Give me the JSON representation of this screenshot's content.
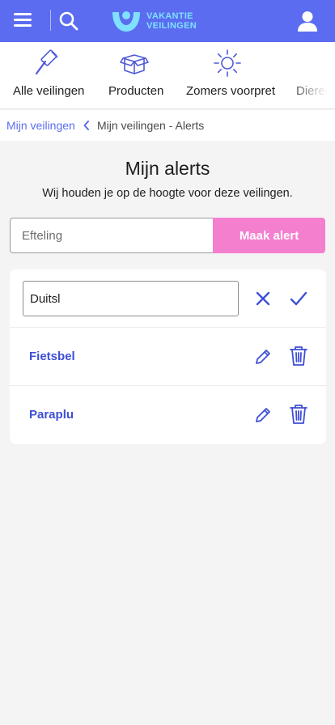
{
  "header": {
    "logo_line1": "VAKANTIE",
    "logo_line2": "VEILINGEN",
    "icons": [
      "menu-icon",
      "search-icon",
      "user-icon"
    ],
    "colors": {
      "bar": "#5b6cf0",
      "logo_text": "#7fe1ff"
    }
  },
  "categories": [
    {
      "label": "Alle veilingen",
      "icon": "gavel-icon"
    },
    {
      "label": "Producten",
      "icon": "box-icon"
    },
    {
      "label": "Zomers voorpret",
      "icon": "sun-icon"
    },
    {
      "label": "Dierent",
      "icon": ""
    }
  ],
  "breadcrumb": {
    "parent": "Mijn veilingen",
    "current": "Mijn veilingen - Alerts"
  },
  "page": {
    "title": "Mijn alerts",
    "subtitle": "Wij houden je op de hoogte voor deze veilingen."
  },
  "new_alert": {
    "placeholder": "Efteling",
    "button_label": "Maak alert",
    "button_color": "#f47fcf"
  },
  "alerts": {
    "editing_value": "Duitsl",
    "items": [
      {
        "label": "Fietsbel"
      },
      {
        "label": "Paraplu"
      }
    ],
    "accent_color": "#3e4fd6"
  }
}
